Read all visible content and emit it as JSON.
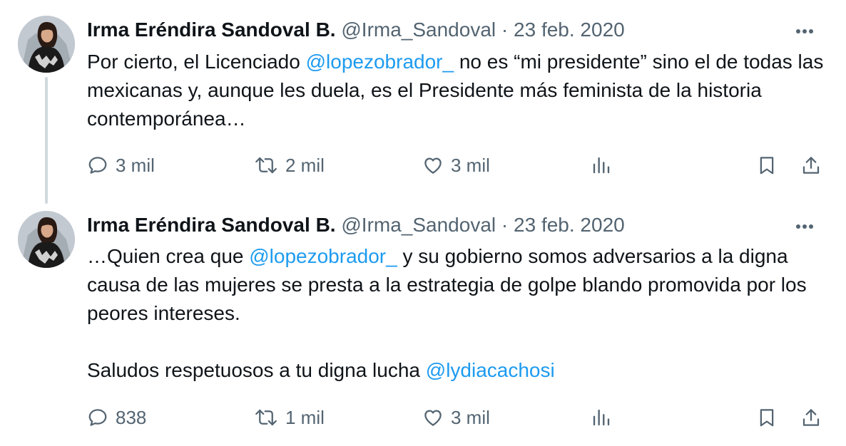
{
  "tweets": [
    {
      "author": {
        "name": "Irma Eréndira Sandoval B.",
        "handle": "@Irma_Sandoval"
      },
      "separator": "·",
      "date": "23 feb. 2020",
      "text": {
        "p1_before": "Por cierto, el Licenciado ",
        "p1_mention": "@lopezobrador_",
        "p1_after": " no es “mi presidente” sino el de todas las mexicanas y, aunque les duela, es el Presidente más feminista de la historia contemporánea…"
      },
      "stats": {
        "replies": "3 mil",
        "retweets": "2 mil",
        "likes": "3 mil"
      }
    },
    {
      "author": {
        "name": "Irma Eréndira Sandoval B.",
        "handle": "@Irma_Sandoval"
      },
      "separator": "·",
      "date": "23 feb. 2020",
      "text": {
        "p1_before": "…Quien crea que ",
        "p1_mention": "@lopezobrador_",
        "p1_after": " y su gobierno somos adversarios a la digna causa de las mujeres se presta a la estrategia de golpe blando promovida por los peores intereses.",
        "p2_before": "Saludos respetuosos a tu digna lucha ",
        "p2_mention": "@lydiacachosi"
      },
      "stats": {
        "replies": "838",
        "retweets": "1 mil",
        "likes": "3 mil"
      }
    }
  ],
  "icons": {
    "more": "more-horizontal-icon",
    "reply": "reply-icon",
    "retweet": "retweet-icon",
    "like": "heart-icon",
    "views": "views-icon",
    "bookmark": "bookmark-icon",
    "share": "share-icon"
  },
  "colors": {
    "text": "#0f1419",
    "secondary": "#536471",
    "link": "#1d9bf0",
    "thread_line": "#cfd9de",
    "background": "#ffffff"
  }
}
